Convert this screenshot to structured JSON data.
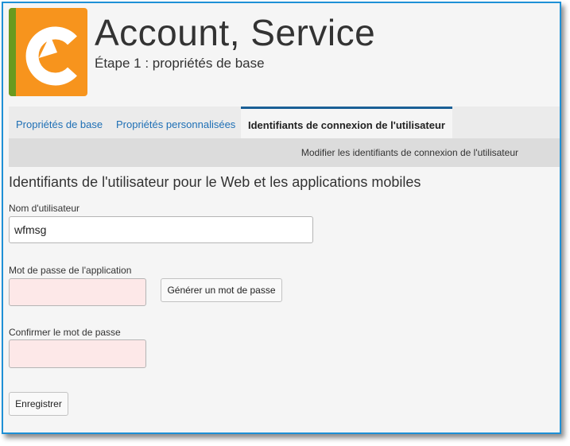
{
  "header": {
    "title": "Account, Service",
    "subtitle": "Étape 1 : propriétés de base"
  },
  "tabs": [
    {
      "label": "Propriétés de base",
      "active": false
    },
    {
      "label": "Propriétés personnalisées",
      "active": false
    },
    {
      "label": "Identifiants de connexion de l'utilisateur",
      "active": true
    }
  ],
  "subbar": {
    "link_label": "Modifier les identifiants de connexion de l'utilisateur"
  },
  "form": {
    "section_title": "Identifiants de l'utilisateur pour le Web et les applications mobiles",
    "username_label": "Nom d'utilisateur",
    "username_value": "wfmsg",
    "password_label": "Mot de passe de l'application",
    "password_value": "",
    "generate_button_label": "Générer un mot de passe",
    "confirm_label": "Confirmer le mot de passe",
    "confirm_value": "",
    "save_button_label": "Enregistrer"
  },
  "colors": {
    "frame_border": "#1e90d6",
    "logo_orange": "#f7941d",
    "logo_green": "#6a9a1f",
    "link_blue": "#1e6fb5",
    "active_tab_border": "#1a5f96",
    "required_field_bg": "#fde8e8"
  },
  "icons": {
    "logo": "app-logo-icon"
  }
}
